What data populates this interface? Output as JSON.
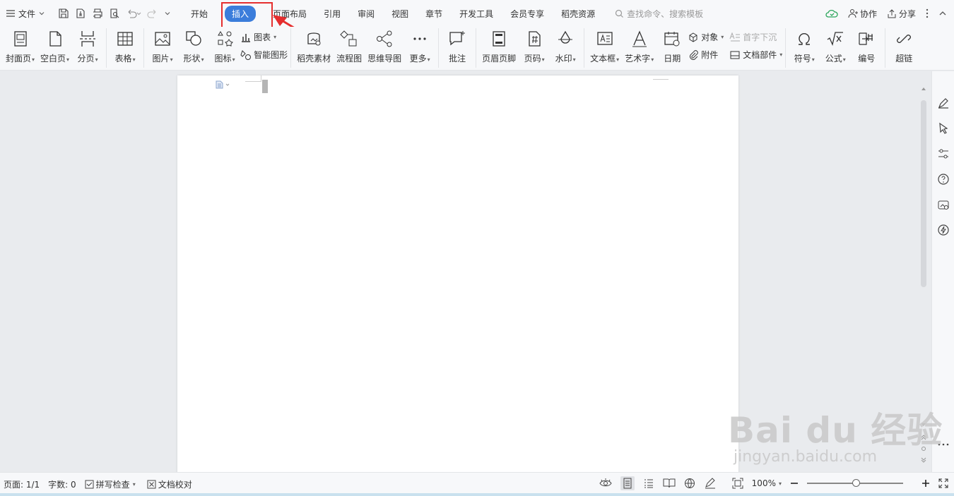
{
  "titlebar": {
    "file_menu": "文件",
    "tabs": [
      "开始",
      "插入",
      "页面布局",
      "引用",
      "审阅",
      "视图",
      "章节",
      "开发工具",
      "会员专享",
      "稻壳资源"
    ],
    "active_tab": "插入",
    "search_placeholder": "查找命令、搜索模板",
    "collaborate": "协作",
    "share": "分享"
  },
  "ribbon": {
    "cover": "封面页",
    "blank": "空白页",
    "page_break": "分页",
    "table": "表格",
    "picture": "图片",
    "shape": "形状",
    "icon": "图标",
    "chart": "图表",
    "smart_art": "智能图形",
    "docer_material": "稻壳素材",
    "flowchart": "流程图",
    "mindmap": "思维导图",
    "more": "更多",
    "comment": "批注",
    "header_footer": "页眉页脚",
    "page_number": "页码",
    "watermark": "水印",
    "textbox": "文本框",
    "wordart": "艺术字",
    "date": "日期",
    "object": "对象",
    "dropcap": "首字下沉",
    "attachment": "附件",
    "doc_parts": "文档部件",
    "symbol": "符号",
    "formula": "公式",
    "numbering": "编号",
    "hyperlink": "超链"
  },
  "statusbar": {
    "page": "页面: 1/1",
    "word_count": "字数: 0",
    "spellcheck": "拼写检查",
    "proofread": "文档校对",
    "zoom": "100%"
  },
  "watermark": {
    "line1": "Bai du 经验",
    "line2": "jingyan.baidu.com"
  },
  "colors": {
    "accent": "#3b7ddb",
    "highlight": "#e52e2e"
  }
}
